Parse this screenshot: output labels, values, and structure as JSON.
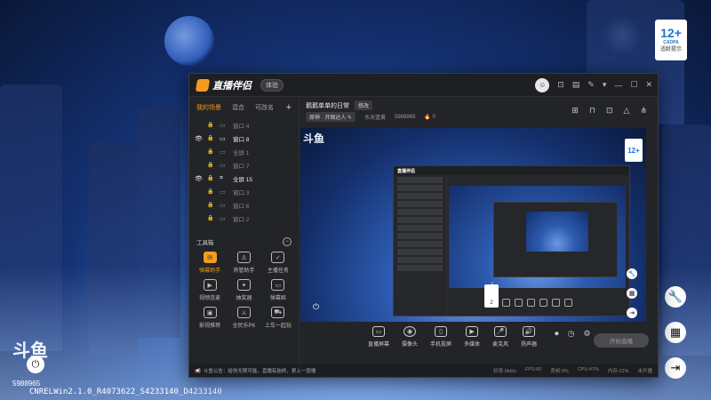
{
  "background": {
    "age_rating": "12+",
    "age_org": "CADPA",
    "age_tip": "适龄提示"
  },
  "overlay": {
    "logo_text": "斗鱼",
    "room_id": "5988965",
    "version": "CNRELWin2.1.0_R4073622_S4233140_D4233140",
    "right_tools": [
      "wrench-icon",
      "calendar-icon",
      "exit-icon"
    ]
  },
  "app": {
    "title": "直播伴侣",
    "edition": "体验",
    "window_controls": [
      "avatar",
      "shirt-icon",
      "message-icon",
      "feedback-icon",
      "dropdown-icon",
      "minimize",
      "restore",
      "close"
    ],
    "sidebar": {
      "tabs": [
        "我的场景",
        "混合",
        "可改名"
      ],
      "active_tab": "我的场景",
      "add_label": "+",
      "scenes": [
        {
          "name": "窗口 4",
          "visible": false,
          "icon": "monitor"
        },
        {
          "name": "窗口 8",
          "visible": true,
          "icon": "monitor"
        },
        {
          "name": "全屏 1",
          "visible": false,
          "icon": "monitor"
        },
        {
          "name": "窗口 7",
          "visible": false,
          "icon": "monitor"
        },
        {
          "name": "全屏 15",
          "visible": true,
          "icon": "crop"
        },
        {
          "name": "窗口 3",
          "visible": false,
          "icon": "monitor"
        },
        {
          "name": "窗口 6",
          "visible": false,
          "icon": "monitor"
        },
        {
          "name": "窗口 2",
          "visible": false,
          "icon": "monitor"
        }
      ],
      "toolbox_title": "工具箱",
      "tools": [
        {
          "label": "弹幕助手",
          "active": true,
          "glyph": "✉"
        },
        {
          "label": "房管助手",
          "active": false,
          "glyph": "♙"
        },
        {
          "label": "主播任务",
          "active": false,
          "glyph": "✓"
        },
        {
          "label": "视频连麦",
          "active": false,
          "glyph": "▶"
        },
        {
          "label": "抽奖器",
          "active": false,
          "glyph": "✦"
        },
        {
          "label": "弹幕姬",
          "active": false,
          "glyph": "▭"
        },
        {
          "label": "影视推荐",
          "active": false,
          "glyph": "▣"
        },
        {
          "label": "全民乐PK",
          "active": false,
          "glyph": "⚔"
        },
        {
          "label": "上车一起玩",
          "active": false,
          "glyph": "⛟"
        }
      ]
    },
    "room": {
      "title": "鹅鹅单单的日常",
      "edit_label": "修改",
      "category": "原神 · 开图达人",
      "streamer": "水冰蓝黄",
      "room_id": "5988965",
      "hot": "0"
    },
    "controls": [
      {
        "label": "直播屏幕",
        "glyph": "▭"
      },
      {
        "label": "摄像头",
        "glyph": "◉"
      },
      {
        "label": "手机投屏",
        "glyph": "▯"
      },
      {
        "label": "多媒体",
        "glyph": "▶"
      },
      {
        "label": "麦克风",
        "glyph": "🎤"
      },
      {
        "label": "扬声器",
        "glyph": "🔊"
      }
    ],
    "start_label": "开始直播",
    "status": {
      "notice_label": "斗鱼公告",
      "notice": "给你无限可能，直播有始终，更上一层楼",
      "bitrate": "码率:0kb/s",
      "fps": "FPS:60",
      "drop": "丢帧:0%",
      "cpu": "CPU:47%",
      "mem": "内存:22%",
      "time": "未开播"
    }
  }
}
